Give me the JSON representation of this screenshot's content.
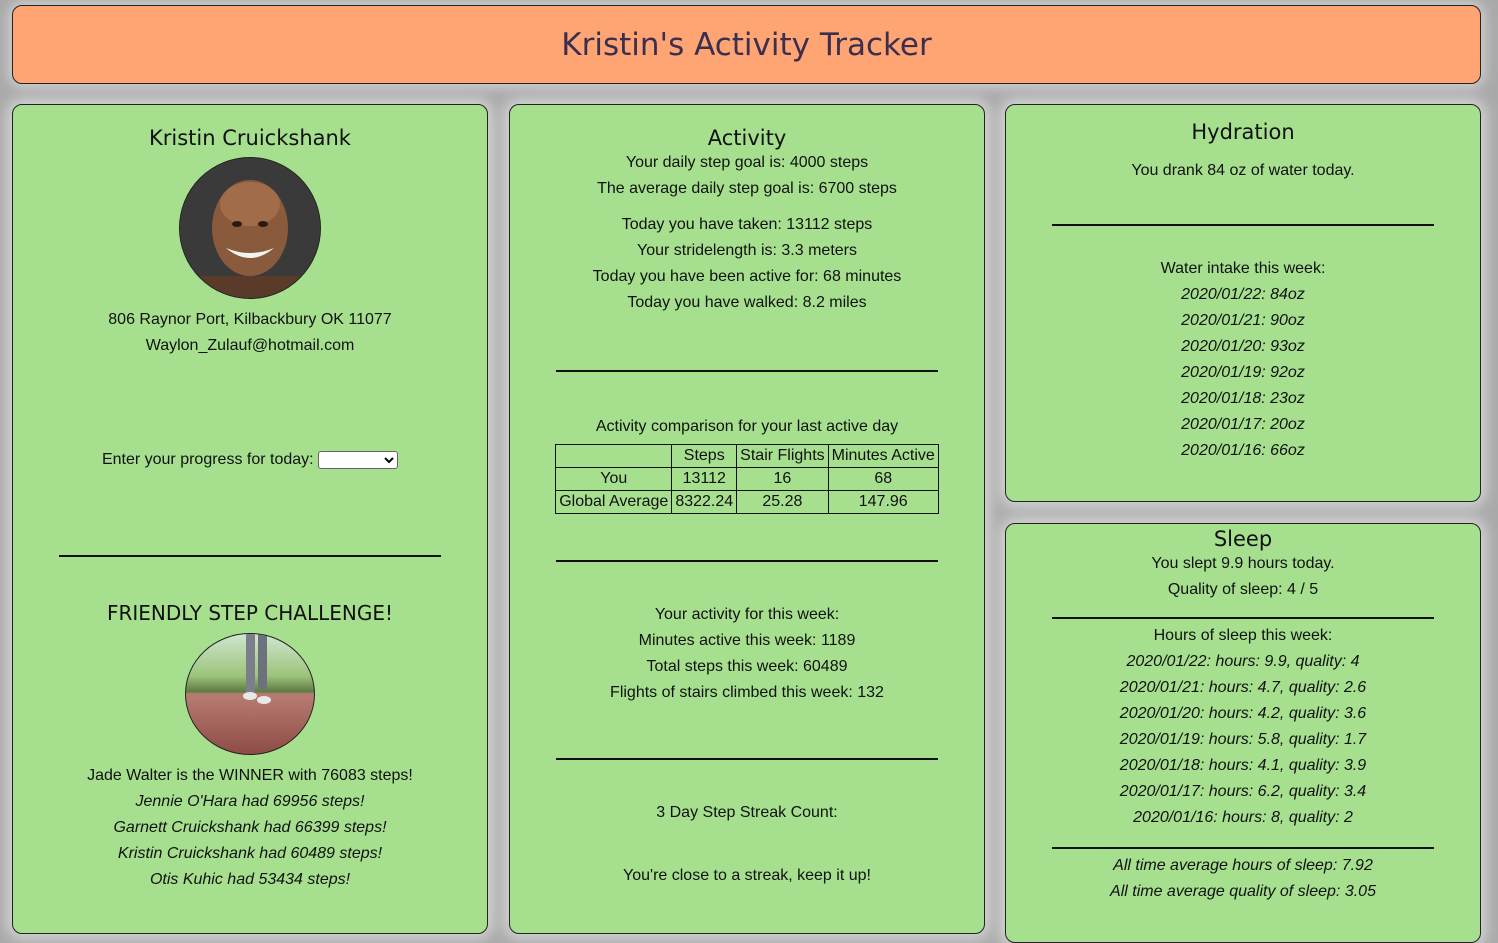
{
  "header": {
    "title": "Kristin's Activity Tracker"
  },
  "profile": {
    "name": "Kristin Cruickshank",
    "address": "806 Raynor Port, Kilbackbury OK 11077",
    "email": "Waylon_Zulauf@hotmail.com",
    "progress_label": "Enter your progress for today:",
    "progress_selected": ""
  },
  "challenge": {
    "title": "FRIENDLY STEP CHALLENGE!",
    "winner": "Jade Walter is the WINNER with 76083 steps!",
    "others": [
      "Jennie O'Hara had 69956 steps!",
      "Garnett Cruickshank had 66399 steps!",
      "Kristin Cruickshank had 60489 steps!",
      "Otis Kuhic had 53434 steps!"
    ]
  },
  "activity": {
    "title": "Activity",
    "goal": "Your daily step goal is: 4000 steps",
    "avg_goal": "The average daily step goal is: 6700 steps",
    "today_steps": "Today you have taken: 13112 steps",
    "stride": "Your stridelength is: 3.3 meters",
    "active": "Today you have been active for: 68 minutes",
    "walked": "Today you have walked: 8.2 miles",
    "comparison_title": "Activity comparison for your last active day",
    "table": {
      "headers": [
        "",
        "Steps",
        "Stair Flights",
        "Minutes Active"
      ],
      "rows": [
        [
          "You",
          "13112",
          "16",
          "68"
        ],
        [
          "Global Average",
          "8322.24",
          "25.28",
          "147.96"
        ]
      ]
    },
    "week_title": "Your activity for this week:",
    "week_minutes": "Minutes active this week: 1189",
    "week_steps": "Total steps this week: 60489",
    "week_flights": "Flights of stairs climbed this week: 132",
    "streak_title": "3 Day Step Streak Count:",
    "streak_msg": "You're close to a streak, keep it up!"
  },
  "hydration": {
    "title": "Hydration",
    "today": "You drank 84 oz of water today.",
    "week_title": "Water intake this week:",
    "week": [
      "2020/01/22: 84oz",
      "2020/01/21: 90oz",
      "2020/01/20: 93oz",
      "2020/01/19: 92oz",
      "2020/01/18: 23oz",
      "2020/01/17: 20oz",
      "2020/01/16: 66oz"
    ]
  },
  "sleep": {
    "title": "Sleep",
    "today": "You slept 9.9 hours today.",
    "quality": "Quality of sleep: 4 / 5",
    "week_title": "Hours of sleep this week:",
    "week": [
      "2020/01/22: hours: 9.9, quality: 4",
      "2020/01/21: hours: 4.7, quality: 2.6",
      "2020/01/20: hours: 4.2, quality: 3.6",
      "2020/01/19: hours: 5.8, quality: 1.7",
      "2020/01/18: hours: 4.1, quality: 3.9",
      "2020/01/17: hours: 6.2, quality: 3.4",
      "2020/01/16: hours: 8, quality: 2"
    ],
    "avg_hours": "All time average hours of sleep: 7.92",
    "avg_quality": "All time average quality of sleep: 3.05"
  }
}
